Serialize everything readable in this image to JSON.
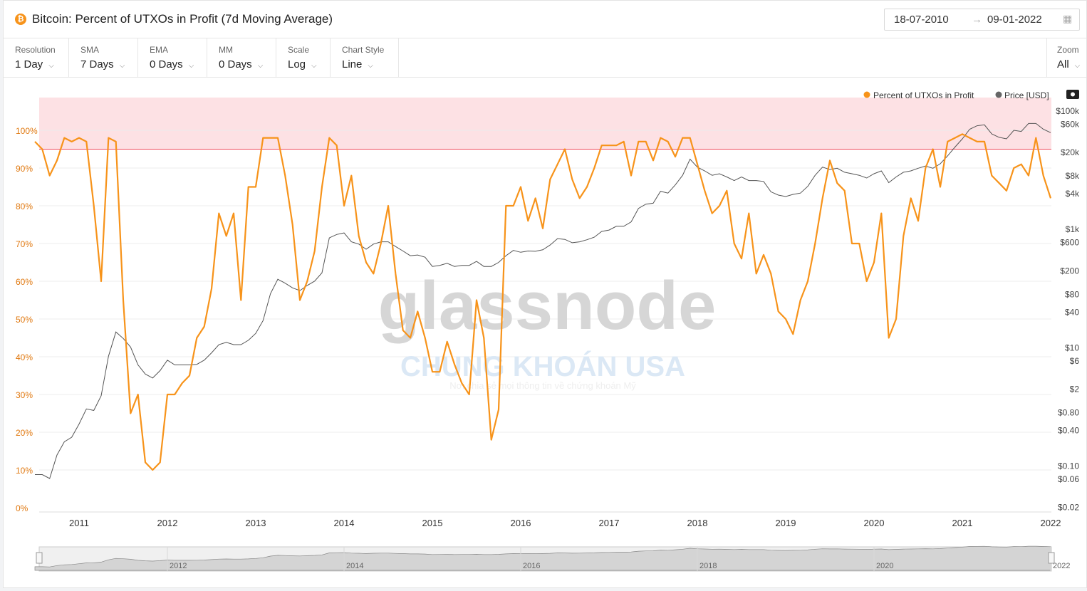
{
  "header": {
    "icon": "bitcoin-icon",
    "title": "Bitcoin: Percent of UTXOs in Profit (7d Moving Average)",
    "date_from": "18-07-2010",
    "date_arrow": "→",
    "date_to": "09-01-2022"
  },
  "controls": [
    {
      "label": "Resolution",
      "value": "1 Day"
    },
    {
      "label": "SMA",
      "value": "7 Days"
    },
    {
      "label": "EMA",
      "value": "0 Days"
    },
    {
      "label": "MM",
      "value": "0 Days"
    },
    {
      "label": "Scale",
      "value": "Log"
    },
    {
      "label": "Chart Style",
      "value": "Line"
    }
  ],
  "zoom": {
    "label": "Zoom",
    "value": "All"
  },
  "watermark": {
    "brand": "glassnode",
    "overlay": "CHUNG KHOÁN USA",
    "overlay_sub": "Nơi chia sẻ mọi thông tin về chứng khoán Mỹ"
  },
  "chart_data": {
    "type": "line",
    "legend_position": "top-right",
    "colors": {
      "percent": "#f7931a",
      "price": "#555555",
      "band": "#fde1e4",
      "threshold": "#f04a5a"
    },
    "threshold_band": {
      "from": 95,
      "to": "top"
    },
    "x_ticks": [
      "2011",
      "2012",
      "2013",
      "2014",
      "2015",
      "2016",
      "2017",
      "2018",
      "2019",
      "2020",
      "2021",
      "2022"
    ],
    "navigator_ticks": [
      "2012",
      "2014",
      "2016",
      "2018",
      "2020",
      "2022"
    ],
    "y_left": {
      "ticks": [
        "0%",
        "10%",
        "20%",
        "30%",
        "40%",
        "50%",
        "60%",
        "70%",
        "80%",
        "90%",
        "100%"
      ],
      "range": [
        0,
        108.6
      ]
    },
    "y_right": {
      "scale": "log",
      "ticks": [
        {
          "label": "$100k",
          "v": 100000
        },
        {
          "label": "$60k",
          "v": 60000
        },
        {
          "label": "$20k",
          "v": 20000
        },
        {
          "label": "$8k",
          "v": 8000
        },
        {
          "label": "$4k",
          "v": 4000
        },
        {
          "label": "$1k",
          "v": 1000
        },
        {
          "label": "$600",
          "v": 600
        },
        {
          "label": "$200",
          "v": 200
        },
        {
          "label": "$80",
          "v": 80
        },
        {
          "label": "$40",
          "v": 40
        },
        {
          "label": "$10",
          "v": 10
        },
        {
          "label": "$6",
          "v": 6
        },
        {
          "label": "$2",
          "v": 2
        },
        {
          "label": "$0.80",
          "v": 0.8
        },
        {
          "label": "$0.40",
          "v": 0.4
        },
        {
          "label": "$0.10",
          "v": 0.1
        },
        {
          "label": "$0.06",
          "v": 0.06
        },
        {
          "label": "$0.02",
          "v": 0.02
        }
      ]
    },
    "start": "2010-07",
    "end": "2022-01",
    "series": [
      {
        "name": "Percent of UTXOs in Profit",
        "axis": "left",
        "monthly": [
          97,
          95,
          88,
          92,
          98,
          97,
          98,
          97,
          80,
          60,
          98,
          97,
          55,
          25,
          30,
          12,
          10,
          12,
          30,
          30,
          33,
          35,
          45,
          48,
          58,
          78,
          72,
          78,
          55,
          85,
          85,
          98,
          98,
          98,
          88,
          75,
          55,
          60,
          68,
          85,
          98,
          96,
          80,
          88,
          72,
          65,
          62,
          70,
          80,
          62,
          47,
          45,
          52,
          45,
          36,
          36,
          44,
          38,
          33,
          30,
          55,
          45,
          18,
          26,
          80,
          80,
          85,
          76,
          82,
          74,
          87,
          91,
          95,
          87,
          82,
          85,
          90,
          96,
          96,
          96,
          97,
          88,
          97,
          97,
          92,
          98,
          97,
          93,
          98,
          98,
          91,
          84,
          78,
          80,
          84,
          70,
          66,
          78,
          62,
          67,
          62,
          52,
          50,
          46,
          55,
          60,
          70,
          82,
          92,
          86,
          84,
          70,
          70,
          60,
          65,
          78,
          45,
          50,
          72,
          82,
          76,
          90,
          95,
          85,
          97,
          98,
          99,
          98,
          97,
          97,
          88,
          86,
          84,
          90,
          91,
          88,
          98,
          88,
          82
        ]
      },
      {
        "name": "Price [USD]",
        "axis": "right",
        "monthly": [
          0.07,
          0.07,
          0.06,
          0.15,
          0.25,
          0.3,
          0.5,
          0.9,
          0.85,
          1.5,
          7,
          18,
          14,
          10,
          5,
          3.5,
          3,
          4,
          6,
          5,
          5,
          5,
          5.1,
          6,
          8,
          11,
          12,
          11,
          11,
          13,
          17,
          28,
          80,
          140,
          120,
          100,
          90,
          110,
          130,
          180,
          700,
          800,
          850,
          600,
          550,
          450,
          550,
          600,
          600,
          500,
          420,
          350,
          360,
          330,
          230,
          240,
          260,
          230,
          240,
          240,
          280,
          230,
          230,
          270,
          350,
          430,
          400,
          420,
          415,
          440,
          530,
          680,
          660,
          580,
          600,
          650,
          720,
          900,
          950,
          1100,
          1100,
          1300,
          2200,
          2600,
          2700,
          4300,
          4000,
          5500,
          8000,
          15000,
          11000,
          9500,
          8000,
          8500,
          7500,
          6500,
          7500,
          6500,
          6500,
          6300,
          4200,
          3700,
          3500,
          3800,
          4000,
          5200,
          8000,
          11000,
          10000,
          10500,
          9000,
          8500,
          8000,
          7200,
          8500,
          9500,
          6000,
          7500,
          9000,
          9500,
          10500,
          11500,
          10500,
          12500,
          17000,
          24000,
          33000,
          48000,
          55000,
          57000,
          40000,
          35000,
          33000,
          46000,
          44000,
          60000,
          60000,
          48000,
          42000
        ]
      }
    ]
  }
}
